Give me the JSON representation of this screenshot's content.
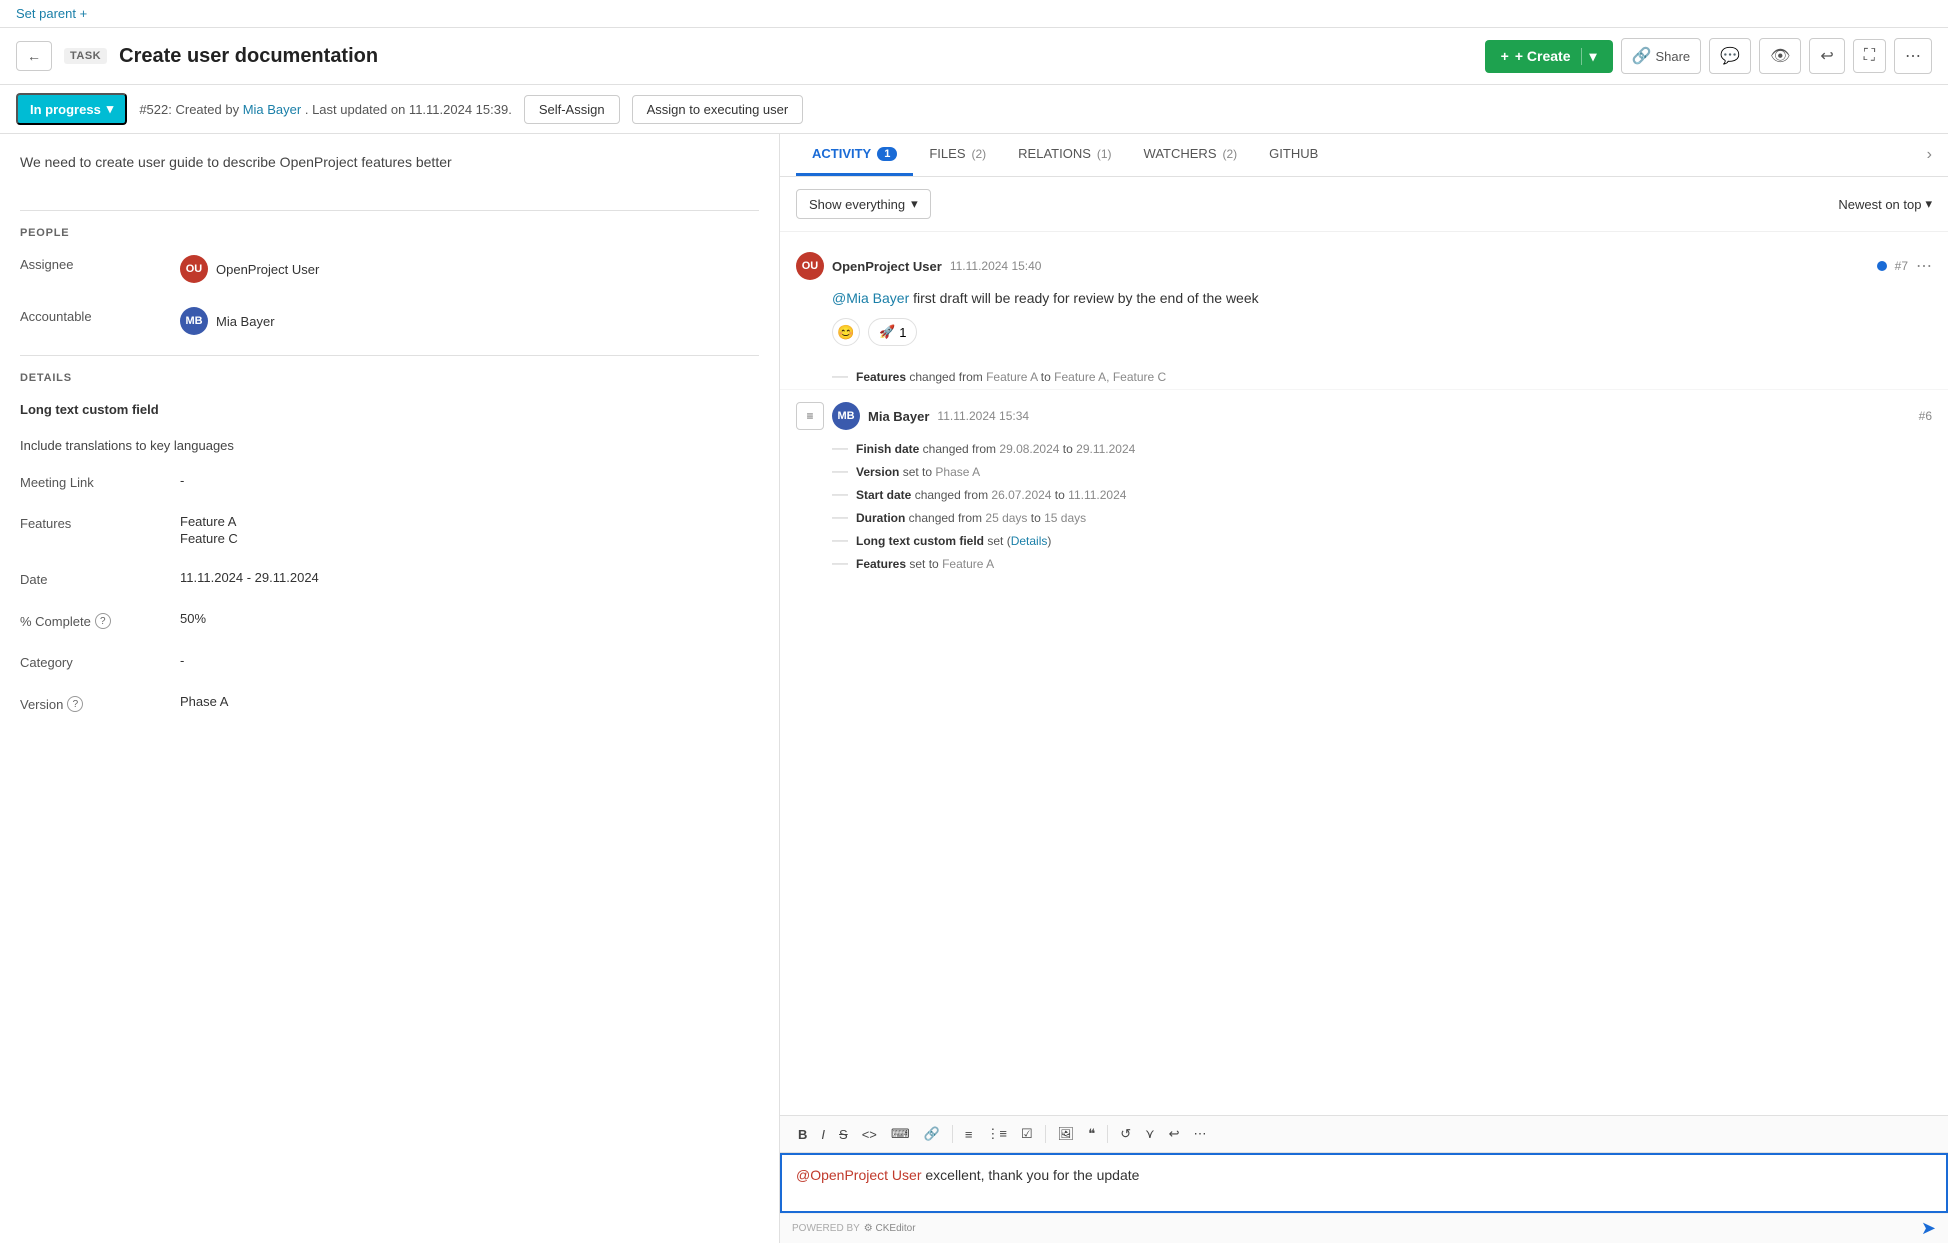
{
  "top_bar": {
    "set_parent_label": "Set parent +"
  },
  "header": {
    "back_icon": "←",
    "task_label": "TASK",
    "title": "Create user documentation",
    "create_label": "+ Create",
    "share_label": "Share",
    "icons": [
      "💬",
      "👁",
      "↩",
      "⛶",
      "⋯"
    ]
  },
  "status_bar": {
    "status_label": "In progress",
    "status_arrow": "▾",
    "meta_text": "#522: Created by",
    "meta_author": "Mia Bayer",
    "meta_date": ". Last updated on 11.11.2024 15:39.",
    "self_assign_label": "Self-Assign",
    "assign_executing_label": "Assign to executing user"
  },
  "description": {
    "text": "We need to create user guide to describe OpenProject features better"
  },
  "people_section": {
    "title": "PEOPLE",
    "assignee_label": "Assignee",
    "assignee_avatar": "OU",
    "assignee_name": "OpenProject User",
    "accountable_label": "Accountable",
    "accountable_avatar": "MB",
    "accountable_name": "Mia Bayer"
  },
  "details_section": {
    "title": "DETAILS",
    "long_text_field_label": "Long text custom field",
    "long_text_value": "Include translations to key languages",
    "meeting_link_label": "Meeting Link",
    "meeting_link_value": "-",
    "features_label": "Features",
    "features_values": [
      "Feature A",
      "Feature C"
    ],
    "date_label": "Date",
    "date_value": "11.11.2024 - 29.11.2024",
    "percent_label": "% Complete",
    "percent_value": "50%",
    "category_label": "Category",
    "category_value": "-",
    "version_label": "Version",
    "version_value": "Phase A"
  },
  "tabs": [
    {
      "label": "ACTIVITY",
      "count": "1",
      "active": true
    },
    {
      "label": "FILES",
      "count": "(2)",
      "active": false
    },
    {
      "label": "RELATIONS",
      "count": "(1)",
      "active": false
    },
    {
      "label": "WATCHERS",
      "count": "(2)",
      "active": false
    },
    {
      "label": "GITHUB",
      "count": "",
      "active": false
    }
  ],
  "activity": {
    "filter_label": "Show everything",
    "filter_arrow": "▾",
    "sort_label": "Newest on top",
    "sort_arrow": "▾",
    "comments": [
      {
        "avatar": "OU",
        "avatar_color": "red",
        "author": "OpenProject User",
        "time": "11.11.2024 15:40",
        "has_dot": true,
        "id": "#7",
        "mention": "@Mia Bayer",
        "body": " first draft will be ready for review by the end of the week",
        "emoji_label": "😊",
        "reaction_icon": "🚀",
        "reaction_count": "1"
      }
    ],
    "changes_features": {
      "text": "Features",
      "changed_from": "Feature A",
      "changed_to": "Feature A, Feature C"
    },
    "entry2": {
      "avatar": "MB",
      "avatar_color": "blue",
      "author": "Mia Bayer",
      "time": "11.11.2024 15:34",
      "id": "#6",
      "changes": [
        {
          "label": "Finish date",
          "text": "changed from",
          "from": "29.08.2024",
          "to": "29.11.2024"
        },
        {
          "label": "Version",
          "text": "set to",
          "val": "Phase A"
        },
        {
          "label": "Start date",
          "text": "changed from",
          "from": "26.07.2024",
          "to": "11.11.2024"
        },
        {
          "label": "Duration",
          "text": "changed from",
          "from": "25 days",
          "to": "15 days"
        },
        {
          "label": "Long text custom field",
          "text": "set (",
          "link": "Details",
          "end": ")"
        },
        {
          "label": "Features",
          "text": "set to",
          "val": "Feature A"
        }
      ]
    }
  },
  "editor": {
    "toolbar_buttons": [
      "B",
      "I",
      "S",
      "<>",
      "⌨",
      "🔗",
      "≡",
      "⋮≡",
      "☑",
      "🖼",
      "❝",
      "↺",
      "⋎",
      "↩",
      "⋯"
    ],
    "mention": "@OpenProject User",
    "body": " excellent, thank you for the update",
    "powered_by": "POWERED BY",
    "ck_editor": "CKEditor",
    "send_icon": "➤"
  }
}
